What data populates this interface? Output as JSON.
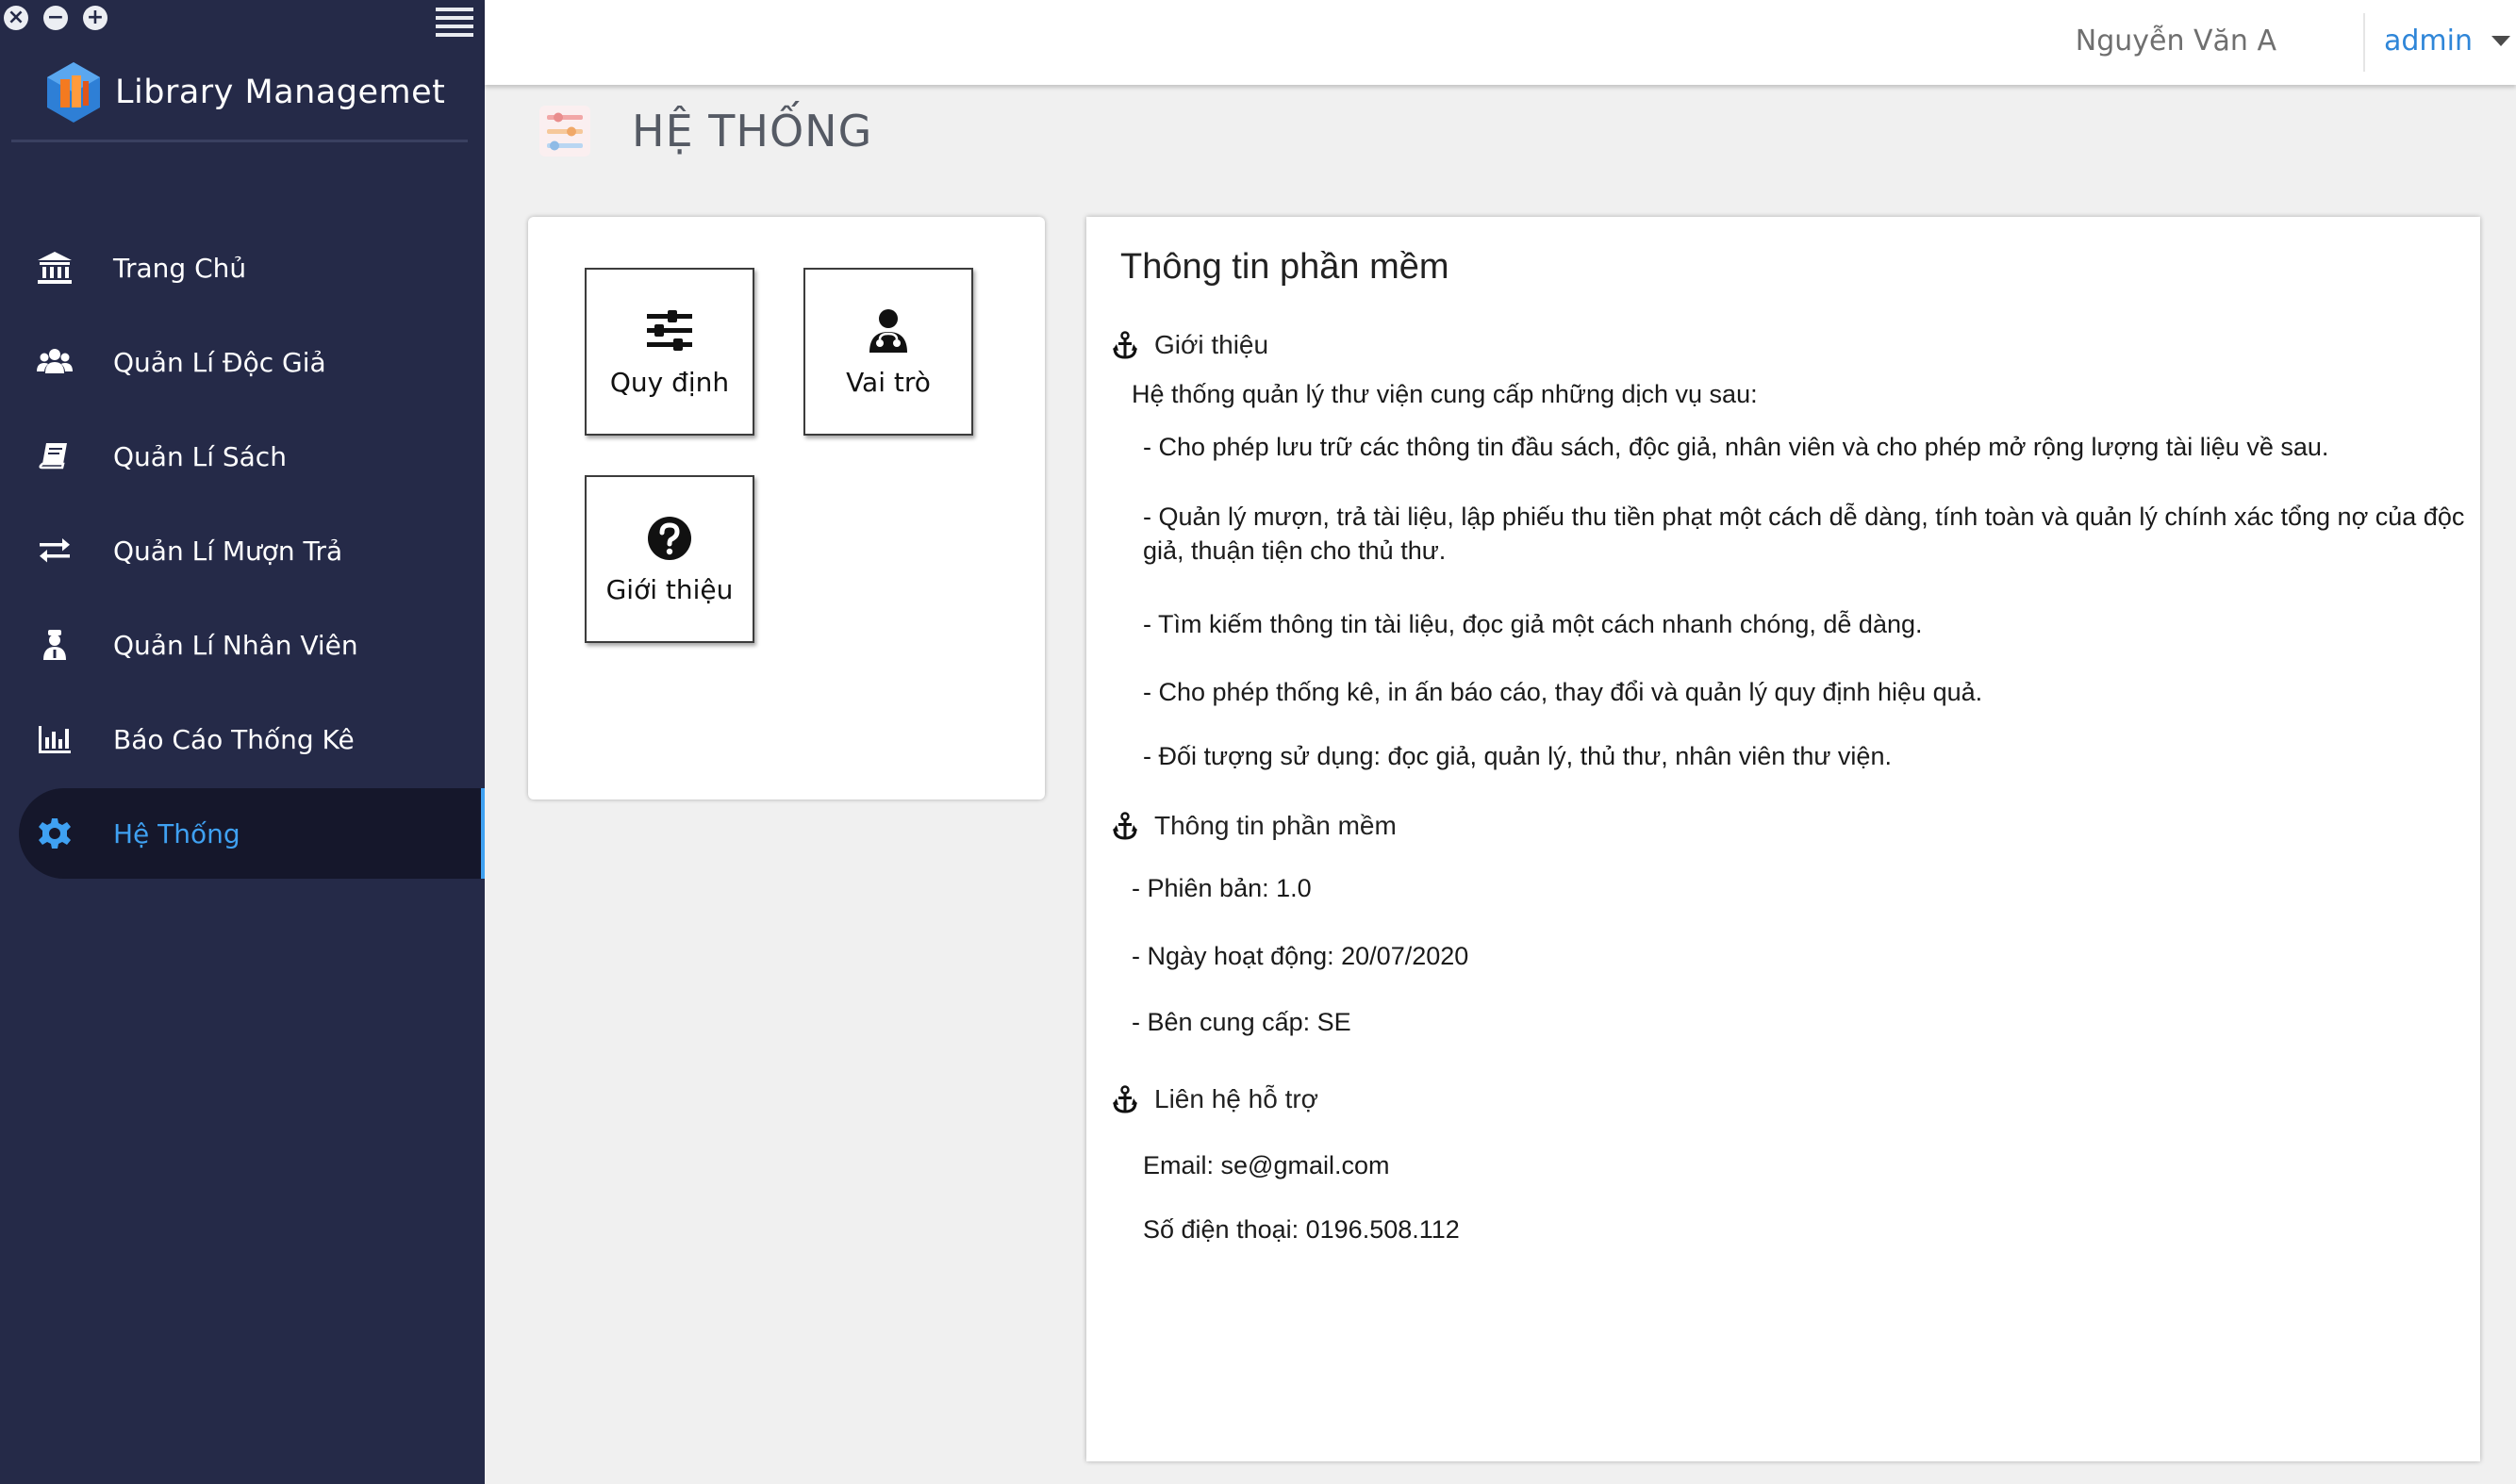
{
  "window": {
    "controls": [
      "×",
      "−",
      "+"
    ]
  },
  "sidebar": {
    "brand": "Library Managemet",
    "items": [
      {
        "label": "Trang Chủ",
        "icon": "bank-icon"
      },
      {
        "label": "Quản Lí Độc Giả",
        "icon": "users-icon"
      },
      {
        "label": "Quản Lí Sách",
        "icon": "book-icon"
      },
      {
        "label": "Quản Lí Mượn Trả",
        "icon": "exchange-icon"
      },
      {
        "label": "Quản Lí Nhân Viên",
        "icon": "employee-icon"
      },
      {
        "label": "Báo Cáo Thống Kê",
        "icon": "bar-chart-icon"
      },
      {
        "label": "Hệ Thống",
        "icon": "gear-icon",
        "active": true
      }
    ]
  },
  "header": {
    "user_name": "Nguyễn Văn A",
    "role": "admin"
  },
  "page": {
    "title": "HỆ THỐNG"
  },
  "tiles": [
    {
      "label": "Quy định",
      "icon": "sliders-icon"
    },
    {
      "label": "Vai trò",
      "icon": "user-doctor-icon"
    },
    {
      "label": "Giới thiệu",
      "icon": "question-circle-icon"
    }
  ],
  "info": {
    "title": "Thông tin phần mềm",
    "intro": {
      "heading": "Giới thiệu",
      "lead": "Hệ thống quản lý thư viện cung cấp những dịch vụ sau:",
      "items": [
        "- Cho phép lưu trữ các thông tin đầu sách, độc giả, nhân viên và cho phép mở rộng lượng tài liệu về sau.",
        "- Quản lý mượn, trả tài liệu, lập phiếu thu tiền phạt một cách dễ dàng, tính toàn và quản lý chính xác tổng nợ của độc",
        "giả, thuận tiện cho thủ thư.",
        "- Tìm kiếm thông tin tài liệu, đọc giả một cách nhanh chóng, dễ dàng.",
        "- Cho phép thống kê, in ấn báo cáo, thay đổi và quản lý quy định hiệu quả.",
        "- Đối tượng sử dụng: đọc giả, quản lý, thủ thư, nhân viên thư viện."
      ]
    },
    "software": {
      "heading": "Thông tin phần mềm",
      "version": "- Phiên bản: 1.0",
      "start_date": "- Ngày hoạt động: 20/07/2020",
      "provider": "- Bên cung cấp: SE"
    },
    "support": {
      "heading": "Liên hệ hỗ trợ",
      "email": "Email: se@gmail.com",
      "phone": "Số điện thoại: 0196.508.112"
    }
  },
  "colors": {
    "sidebar_bg": "#252a48",
    "active_item_bg": "#15172b",
    "accent": "#3fa1f2",
    "role_text": "#2f86d8"
  }
}
